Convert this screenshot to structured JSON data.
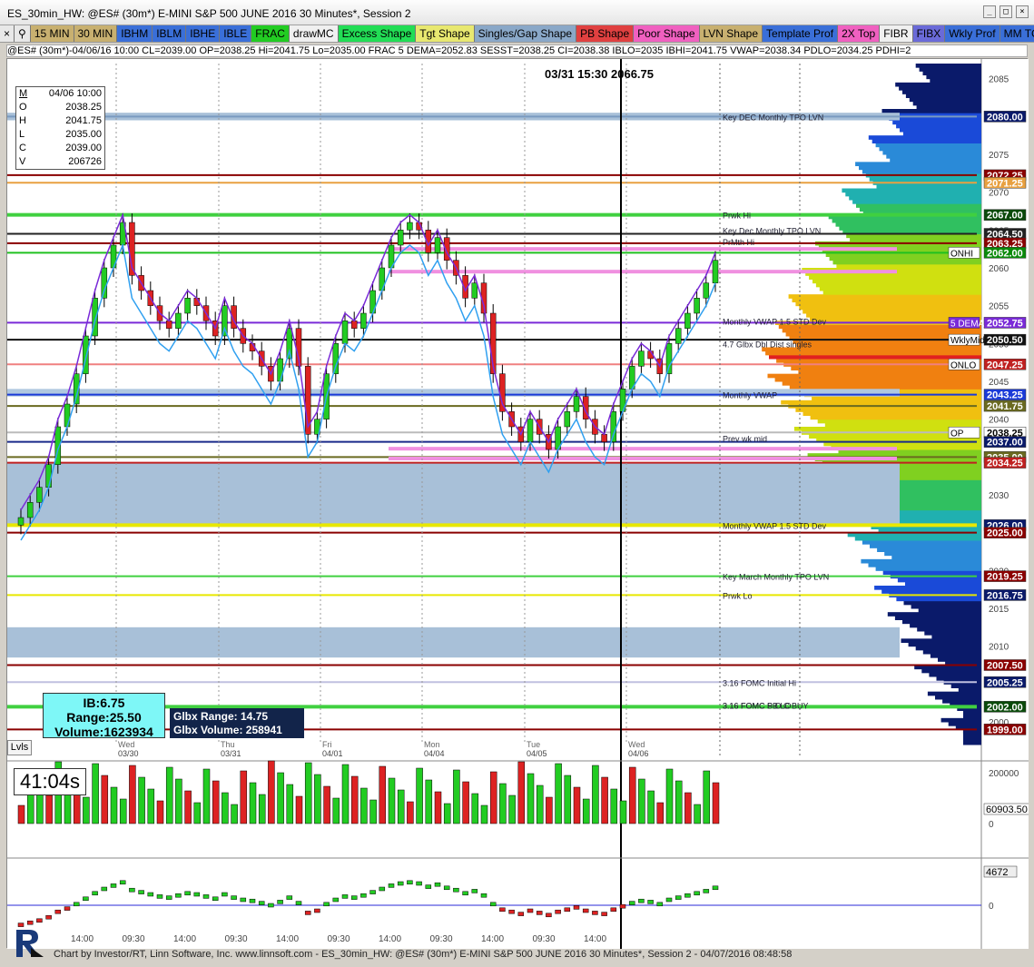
{
  "window": {
    "title": "ES_30min_HW: @ES# (30m*) E-MINI S&P 500 JUNE 2016 30 Minutes*, Session 2"
  },
  "toolbar": {
    "items": [
      {
        "label": "15 MIN",
        "color": "#c8b070"
      },
      {
        "label": "30 MIN",
        "color": "#c8b070"
      },
      {
        "label": "IBHM",
        "color": "#3a6fd8"
      },
      {
        "label": "IBLM",
        "color": "#3a6fd8"
      },
      {
        "label": "IBHE",
        "color": "#3a6fd8"
      },
      {
        "label": "IBLE",
        "color": "#3a6fd8"
      },
      {
        "label": "FRAC",
        "color": "#22cc22"
      },
      {
        "label": "drawMC",
        "color": "#f0f0f0"
      },
      {
        "label": "Excess Shape",
        "color": "#22dd55"
      },
      {
        "label": "Tgt Shape",
        "color": "#e8e870"
      },
      {
        "label": "Singles/Gap Shape",
        "color": "#8aa8c8"
      },
      {
        "label": "PB Shape",
        "color": "#e04040"
      },
      {
        "label": "Poor Shape",
        "color": "#f060c0"
      },
      {
        "label": "LVN Shape",
        "color": "#c8b070"
      },
      {
        "label": "Template Prof",
        "color": "#3a6fd8"
      },
      {
        "label": "2X Top",
        "color": "#f060c0"
      },
      {
        "label": "FIBR",
        "color": "#f0f0f0"
      },
      {
        "label": "FIBX",
        "color": "#6a6ad8"
      },
      {
        "label": "Wkly Prof",
        "color": "#3a6fd8"
      },
      {
        "label": "MM TGT",
        "color": "#3a6fd8"
      }
    ]
  },
  "status_line": "@ES# (30m*)-04/06/16 10:00 CL=2039.00 OP=2038.25 Hi=2041.75 Lo=2035.00  FRAC  5 DEMA=2052.83  SESST=2038.25  CI=2038.38  IBLO=2035  IBHI=2041.75  VWAP=2038.34  PDLO=2034.25  PDHI=2",
  "ohlc_box": {
    "marker": "M",
    "date": "04/06 10:00",
    "rows": [
      {
        "k": "O",
        "v": "2038.25"
      },
      {
        "k": "H",
        "v": "2041.75"
      },
      {
        "k": "L",
        "v": "2035.00"
      },
      {
        "k": "C",
        "v": "2039.00"
      },
      {
        "k": "V",
        "v": "206726"
      }
    ]
  },
  "header_price": "03/31 15:30  2066.75",
  "price_axis": {
    "ticks": [
      "2085",
      "2080",
      "2075",
      "2070",
      "2065",
      "2060",
      "2055",
      "2050",
      "2045",
      "2040",
      "2035",
      "2030",
      "2025",
      "2020",
      "2015",
      "2010",
      "2005",
      "2000"
    ],
    "labels": [
      {
        "text": "2080.00",
        "bg": "#0a1a6a",
        "fg": "#ffffff"
      },
      {
        "text": "2072.25",
        "bg": "#8a0000",
        "fg": "#ffffff"
      },
      {
        "text": "2071.25",
        "bg": "#e8a040",
        "fg": "#ffffff"
      },
      {
        "text": "2067.00",
        "bg": "#0a4a0a",
        "fg": "#ffffff"
      },
      {
        "text": "2064.50",
        "bg": "#222222",
        "fg": "#ffffff"
      },
      {
        "text": "2063.25",
        "bg": "#8a0000",
        "fg": "#ffffff"
      },
      {
        "text": "2062.00",
        "bg": "#0a8a0a",
        "fg": "#ffffff"
      },
      {
        "text": "2052.75",
        "bg": "#7a2ad8",
        "fg": "#ffffff"
      },
      {
        "text": "2050.50",
        "bg": "#111111",
        "fg": "#ffffff"
      },
      {
        "text": "2047.25",
        "bg": "#c02020",
        "fg": "#ffffff"
      },
      {
        "text": "2043.25",
        "bg": "#1a3ad8",
        "fg": "#ffffff"
      },
      {
        "text": "2041.75",
        "bg": "#6a6a20",
        "fg": "#ffffff"
      },
      {
        "text": "2038.25",
        "bg": "#ffffff",
        "fg": "#000000"
      },
      {
        "text": "2037.00",
        "bg": "#0a1a6a",
        "fg": "#ffffff"
      },
      {
        "text": "2035.00",
        "bg": "#6a6a20",
        "fg": "#ffffff"
      },
      {
        "text": "2034.25",
        "bg": "#c02020",
        "fg": "#ffffff"
      },
      {
        "text": "2026.00",
        "bg": "#0a1a6a",
        "fg": "#ffffff"
      },
      {
        "text": "2025.00",
        "bg": "#8a0000",
        "fg": "#ffffff"
      },
      {
        "text": "2019.25",
        "bg": "#8a0000",
        "fg": "#ffffff"
      },
      {
        "text": "2016.75",
        "bg": "#0a1a6a",
        "fg": "#ffffff"
      },
      {
        "text": "2007.50",
        "bg": "#8a0000",
        "fg": "#ffffff"
      },
      {
        "text": "2005.25",
        "bg": "#0a1a6a",
        "fg": "#ffffff"
      },
      {
        "text": "2002.00",
        "bg": "#0a4a0a",
        "fg": "#ffffff"
      },
      {
        "text": "1999.00",
        "bg": "#8a0000",
        "fg": "#ffffff"
      }
    ],
    "side_tags": [
      "ONHI",
      "5 DEMA",
      "WklyMid",
      "ONLO",
      "OP"
    ]
  },
  "annotations": [
    "Key DEC Monthly TPO LVN",
    "Prwk Hi",
    "Key Dec Monthly TPO LVN",
    "PrMth Hi",
    "Monthly VWAP 1.5 STD Dev",
    "4.7 Glbx Dbl Dist singles",
    "Monthly VWAP",
    "Prev wk mid",
    "Monthly VWAP 1.5 STD Dev",
    "Key March Monthly TPO LVN",
    "Prwk Lo",
    "3.16 FOMC Initial Hi",
    "3.16 FOMC PB LO",
    "3.16 FOMC S O C  BUY"
  ],
  "date_labels": [
    {
      "day": "Wed",
      "date": "03/30"
    },
    {
      "day": "Thu",
      "date": "03/31"
    },
    {
      "day": "Fri",
      "date": "04/01"
    },
    {
      "day": "Mon",
      "date": "04/04"
    },
    {
      "day": "Tue",
      "date": "04/05"
    },
    {
      "day": "Wed",
      "date": "04/06"
    }
  ],
  "ib_box": {
    "ib": "IB:6.75",
    "range": "Range:25.50",
    "volume": "Volume:1623934"
  },
  "glbx_box": {
    "range": "Glbx Range:  14.75",
    "volume": "Glbx Volume:  258941"
  },
  "lvls_button": "Lvls",
  "timer": "41:04s",
  "volume_panel": {
    "axis": [
      "200000",
      "0"
    ],
    "last": "60903.50"
  },
  "osc_panel": {
    "axis": [
      "0"
    ],
    "last": "4672"
  },
  "time_axis": [
    "14:00",
    "09:30",
    "14:00",
    "09:30",
    "14:00",
    "09:30",
    "14:00",
    "09:30",
    "14:00",
    "09:30",
    "14:00"
  ],
  "footer": "Chart by Investor/RT, Linn Software, Inc. www.linnsoft.com - ES_30min_HW: @ES# (30m*) E-MINI S&P 500 JUNE 2016 30 Minutes*, Session 2 - 04/07/2016 08:48:58",
  "chart_data": {
    "type": "candlestick",
    "symbol": "@ES# (30m*) E-MINI S&P 500 JUNE 2016",
    "ylim": [
      1997,
      2087
    ],
    "current_bar": {
      "date": "04/06 10:00",
      "open": 2038.25,
      "high": 2041.75,
      "low": 2035.0,
      "close": 2039.0,
      "volume": 206726
    },
    "levels": [
      2080.0,
      2072.25,
      2071.25,
      2067.0,
      2064.5,
      2063.25,
      2062.0,
      2052.75,
      2050.5,
      2047.25,
      2043.25,
      2041.75,
      2038.25,
      2037.0,
      2035.0,
      2034.25,
      2026.0,
      2025.0,
      2019.25,
      2016.75,
      2007.5,
      2005.25,
      2002.0,
      1999.0
    ]
  }
}
